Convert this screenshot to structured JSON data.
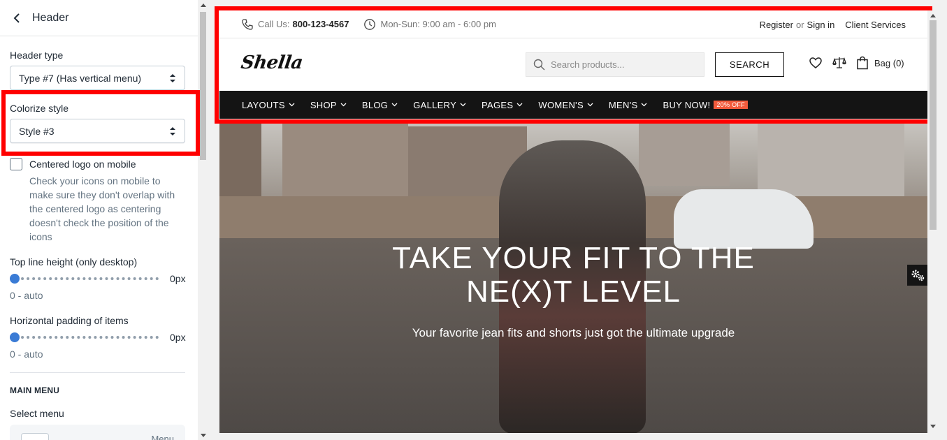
{
  "panel": {
    "title": "Header",
    "header_type_label": "Header type",
    "header_type_value": "Type #7 (Has vertical menu)",
    "colorize_label": "Colorize style",
    "colorize_value": "Style #3",
    "centered_logo_label": "Centered logo on mobile",
    "centered_logo_checked": false,
    "centered_logo_help": "Check your icons on mobile to make sure they don't overlap with the centered logo as centering doesn't check the position of the icons",
    "top_line_label": "Top line height (only desktop)",
    "top_line_value": "0px",
    "top_line_hint": "0 - auto",
    "padding_label": "Horizontal padding of items",
    "padding_value": "0px",
    "padding_hint": "0 - auto",
    "main_menu_heading": "MAIN MENU",
    "select_menu_label": "Select menu",
    "menu_text": "Menu"
  },
  "preview": {
    "topbar": {
      "call_label": "Call Us:",
      "phone": "800-123-4567",
      "hours": "Mon-Sun: 9:00 am - 6:00 pm",
      "register": "Register",
      "or": "or",
      "sign_in": "Sign in",
      "client_services": "Client Services"
    },
    "logo": "Shella",
    "search_placeholder": "Search products...",
    "search_button": "SEARCH",
    "bag_label": "Bag (0)",
    "nav": [
      {
        "label": "LAYOUTS"
      },
      {
        "label": "SHOP"
      },
      {
        "label": "BLOG"
      },
      {
        "label": "GALLERY"
      },
      {
        "label": "PAGES"
      },
      {
        "label": "WOMEN'S"
      },
      {
        "label": "MEN'S"
      }
    ],
    "buy_now": "BUY NOW!",
    "buy_badge": "20% OFF",
    "hero_title_1": "TAKE YOUR FIT TO THE",
    "hero_title_2": "NE(X)T LEVEL",
    "hero_subtitle": "Your favorite jean fits and shorts just got the ultimate upgrade"
  },
  "colors": {
    "highlight": "#ff0000",
    "nav_bg": "#141414",
    "badge": "#f25b3c",
    "slider": "#3a7bd5"
  },
  "icons": [
    "chevron-left-icon",
    "select-arrows-icon",
    "phone-icon",
    "clock-icon",
    "search-icon",
    "heart-icon",
    "compare-scale-icon",
    "bag-icon",
    "chevron-down-icon",
    "gears-icon"
  ]
}
